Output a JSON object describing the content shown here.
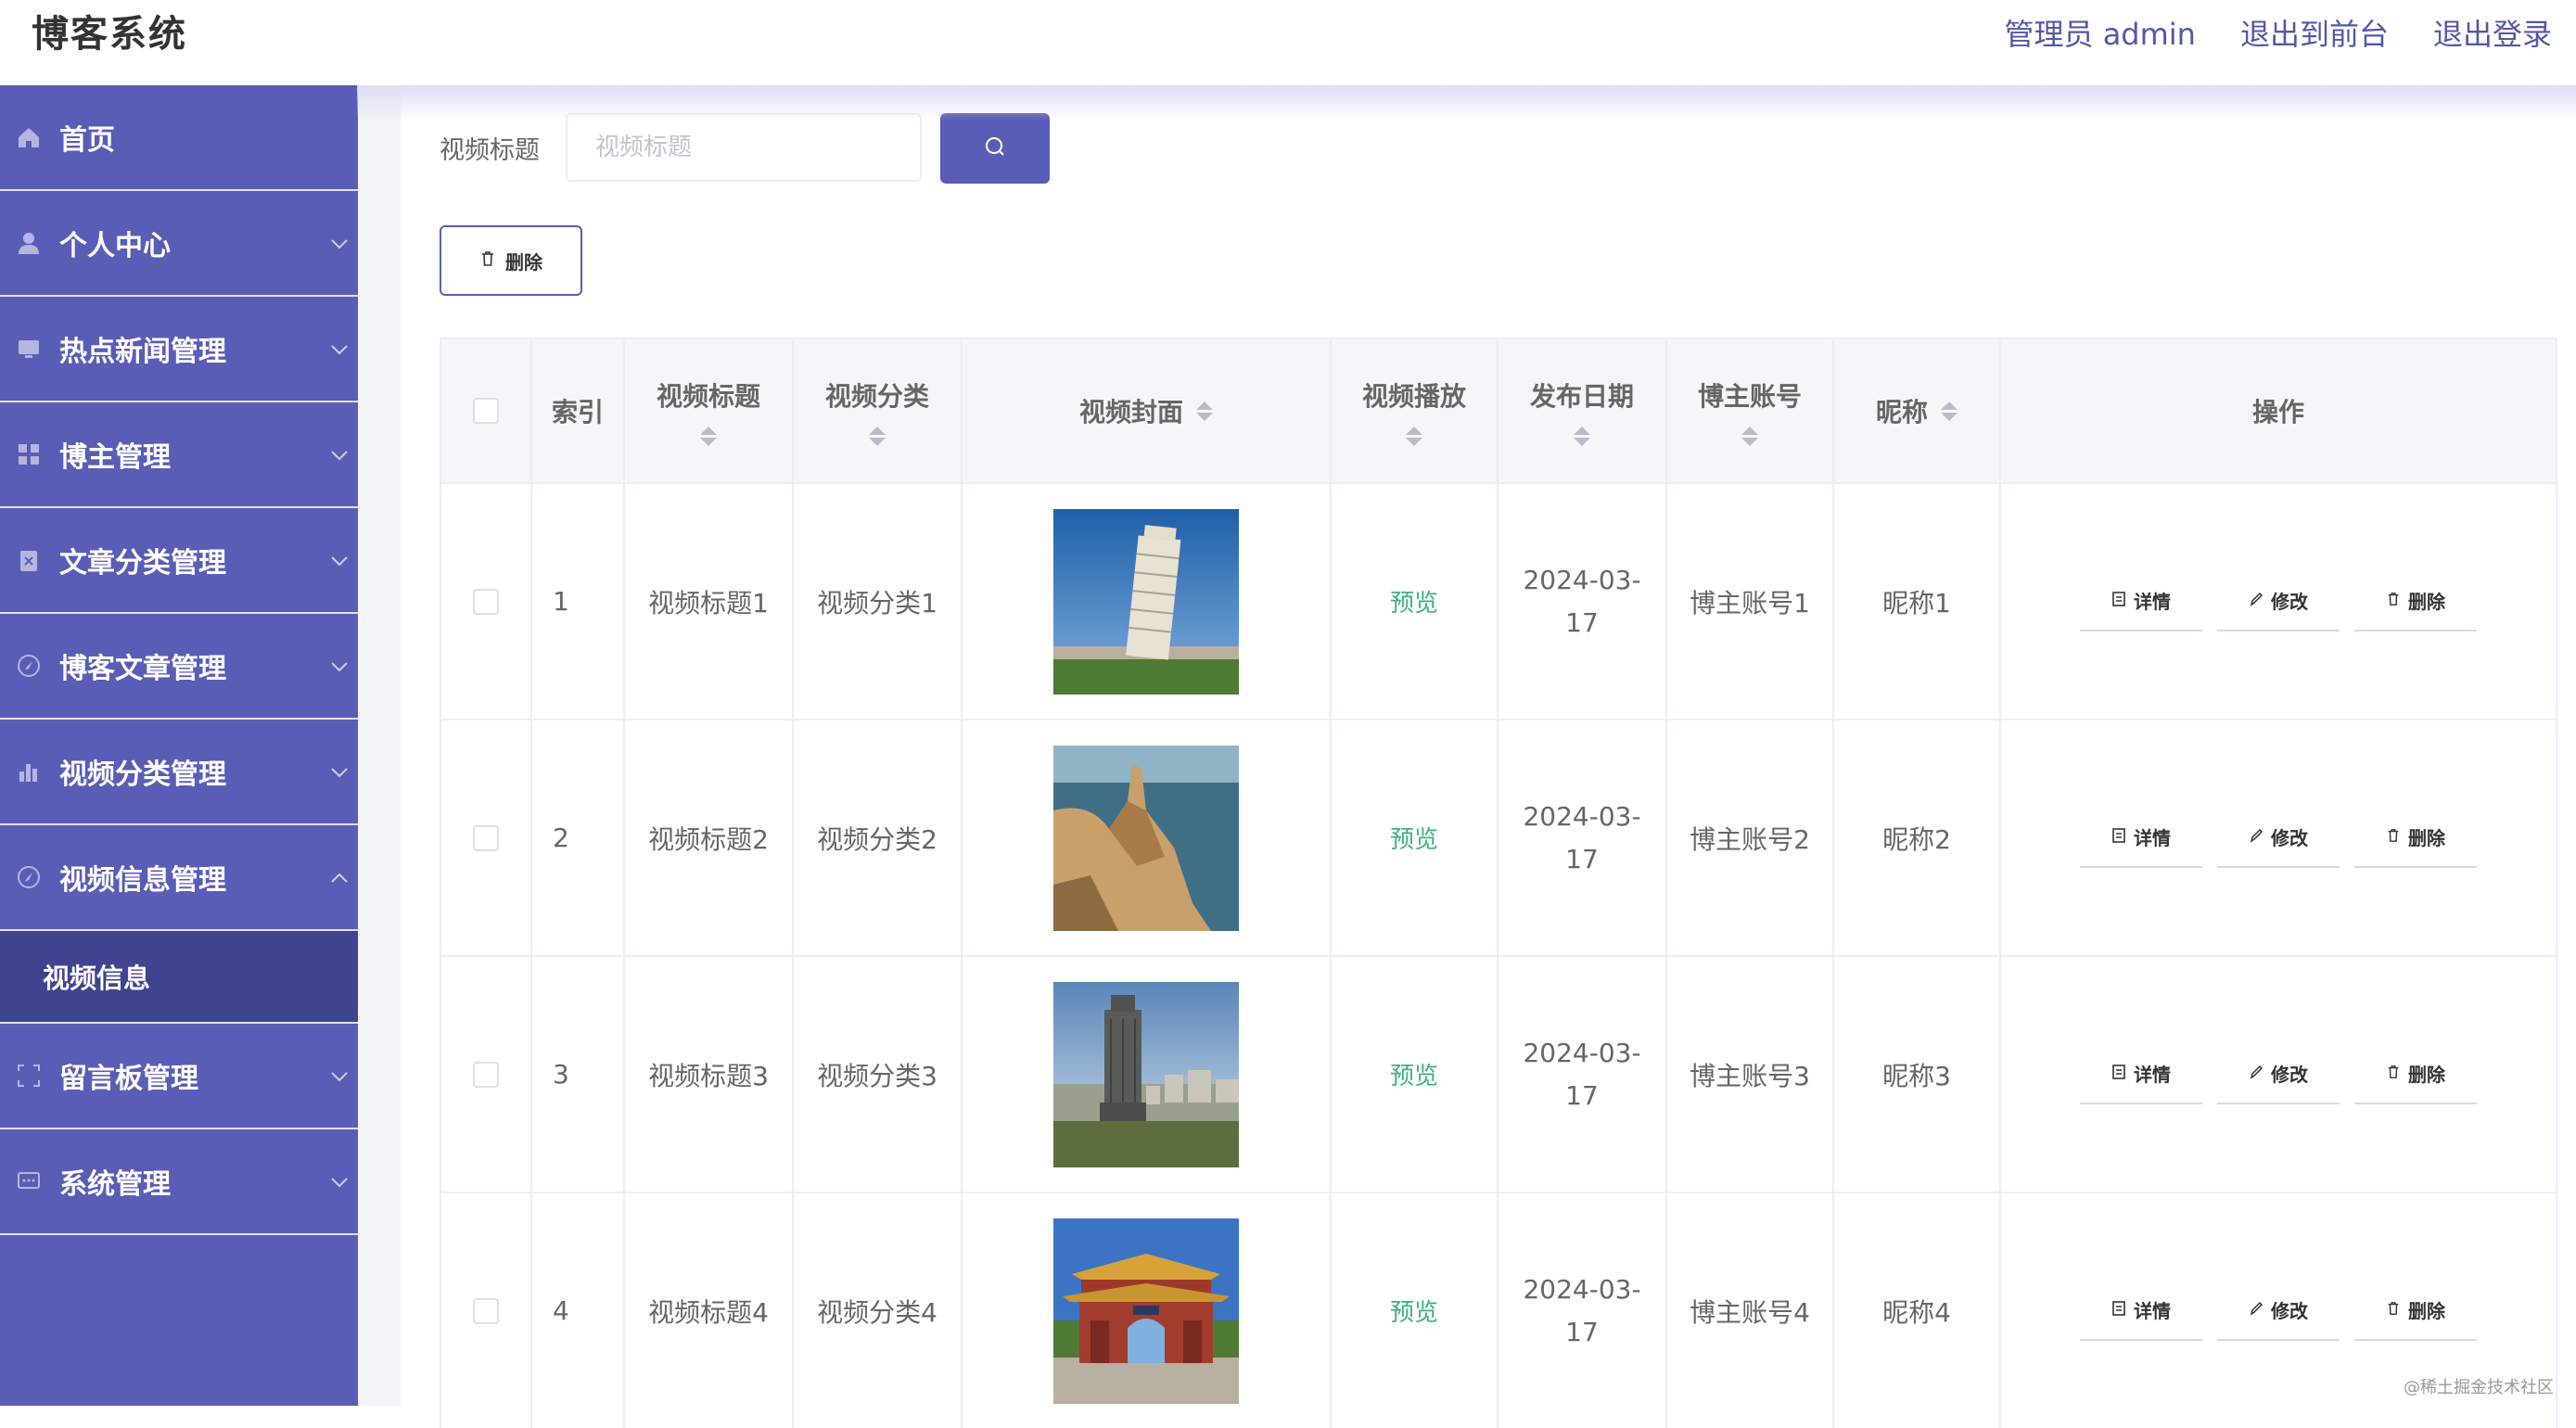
{
  "header": {
    "title": "博客系统",
    "admin_label": "管理员 admin",
    "back_to_front": "退出到前台",
    "logout": "退出登录"
  },
  "sidebar": {
    "items": [
      {
        "label": "首页",
        "icon": "home-icon"
      },
      {
        "label": "个人中心",
        "icon": "user-icon"
      },
      {
        "label": "热点新闻管理",
        "icon": "monitor-icon"
      },
      {
        "label": "博主管理",
        "icon": "grid-icon"
      },
      {
        "label": "文章分类管理",
        "icon": "clipboard-icon"
      },
      {
        "label": "博客文章管理",
        "icon": "compass-icon"
      },
      {
        "label": "视频分类管理",
        "icon": "bar-chart-icon"
      },
      {
        "label": "视频信息管理",
        "icon": "compass-icon"
      },
      {
        "label": "留言板管理",
        "icon": "frame-icon"
      },
      {
        "label": "系统管理",
        "icon": "message-icon"
      }
    ],
    "submenu": {
      "label": "视频信息"
    }
  },
  "search": {
    "label": "视频标题",
    "placeholder": "视频标题"
  },
  "toolbar": {
    "delete_label": "删除"
  },
  "table": {
    "headers": {
      "index": "索引",
      "title": "视频标题",
      "category": "视频分类",
      "cover": "视频封面",
      "play": "视频播放",
      "date": "发布日期",
      "account": "博主账号",
      "nickname": "昵称",
      "ops": "操作"
    },
    "rows": [
      {
        "index": "1",
        "title": "视频标题1",
        "category": "视频分类1",
        "cover": "leaning-tower-photo",
        "play": "预览",
        "date_line1": "2024-03-",
        "date_line2": "17",
        "account": "博主账号1",
        "nickname": "昵称1"
      },
      {
        "index": "2",
        "title": "视频标题2",
        "category": "视频分类2",
        "cover": "sea-cliff-photo",
        "play": "预览",
        "date_line1": "2024-03-",
        "date_line2": "17",
        "account": "博主账号2",
        "nickname": "昵称2"
      },
      {
        "index": "3",
        "title": "视频标题3",
        "category": "视频分类3",
        "cover": "city-monument-photo",
        "play": "预览",
        "date_line1": "2024-03-",
        "date_line2": "17",
        "account": "博主账号3",
        "nickname": "昵称3"
      },
      {
        "index": "4",
        "title": "视频标题4",
        "category": "视频分类4",
        "cover": "chinese-gate-photo",
        "play": "预览",
        "date_line1": "2024-03-",
        "date_line2": "17",
        "account": "博主账号4",
        "nickname": "昵称4"
      }
    ],
    "row_actions": {
      "detail": "详情",
      "edit": "修改",
      "delete": "删除"
    }
  },
  "watermark": "@稀土掘金技术社区",
  "colors": {
    "primary": "#5a5db6",
    "sidebar_active": "#40438f",
    "preview_green": "#3fb27f"
  }
}
